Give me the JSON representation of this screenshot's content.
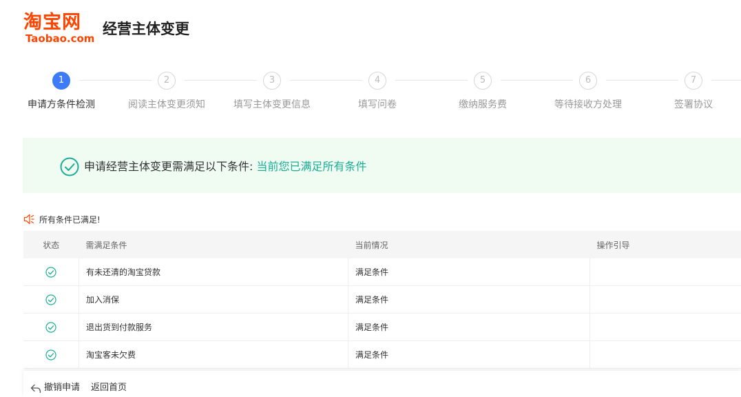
{
  "header": {
    "logo_cn": "淘宝网",
    "logo_en": "Taobao.com",
    "title": "经营主体变更"
  },
  "steps": [
    {
      "num": "1",
      "label": "申请方条件检测",
      "active": true
    },
    {
      "num": "2",
      "label": "阅读主体变更须知",
      "active": false
    },
    {
      "num": "3",
      "label": "填写主体变更信息",
      "active": false
    },
    {
      "num": "4",
      "label": "填写问卷",
      "active": false
    },
    {
      "num": "5",
      "label": "缴纳服务费",
      "active": false
    },
    {
      "num": "6",
      "label": "等待接收方处理",
      "active": false
    },
    {
      "num": "7",
      "label": "签署协议",
      "active": false
    }
  ],
  "banner": {
    "text": "申请经营主体变更需满足以下条件:",
    "highlight": "当前您已满足所有条件"
  },
  "notice": {
    "text": "所有条件已满足!"
  },
  "table": {
    "headers": [
      "状态",
      "需满足条件",
      "当前情况",
      "操作引导"
    ],
    "rows": [
      {
        "condition": "有未还清的淘宝贷款",
        "status": "满足条件",
        "guide": ""
      },
      {
        "condition": "加入消保",
        "status": "满足条件",
        "guide": ""
      },
      {
        "condition": "退出货到付款服务",
        "status": "满足条件",
        "guide": ""
      },
      {
        "condition": "淘宝客未欠费",
        "status": "满足条件",
        "guide": ""
      }
    ]
  },
  "footer": {
    "cancel_label": "撤销申请",
    "home_label": "返回首页"
  },
  "colors": {
    "brand": "#ff4400",
    "active_step": "#3d7bf7",
    "success": "#1aad95",
    "banner_bg": "#f0fcf2"
  }
}
